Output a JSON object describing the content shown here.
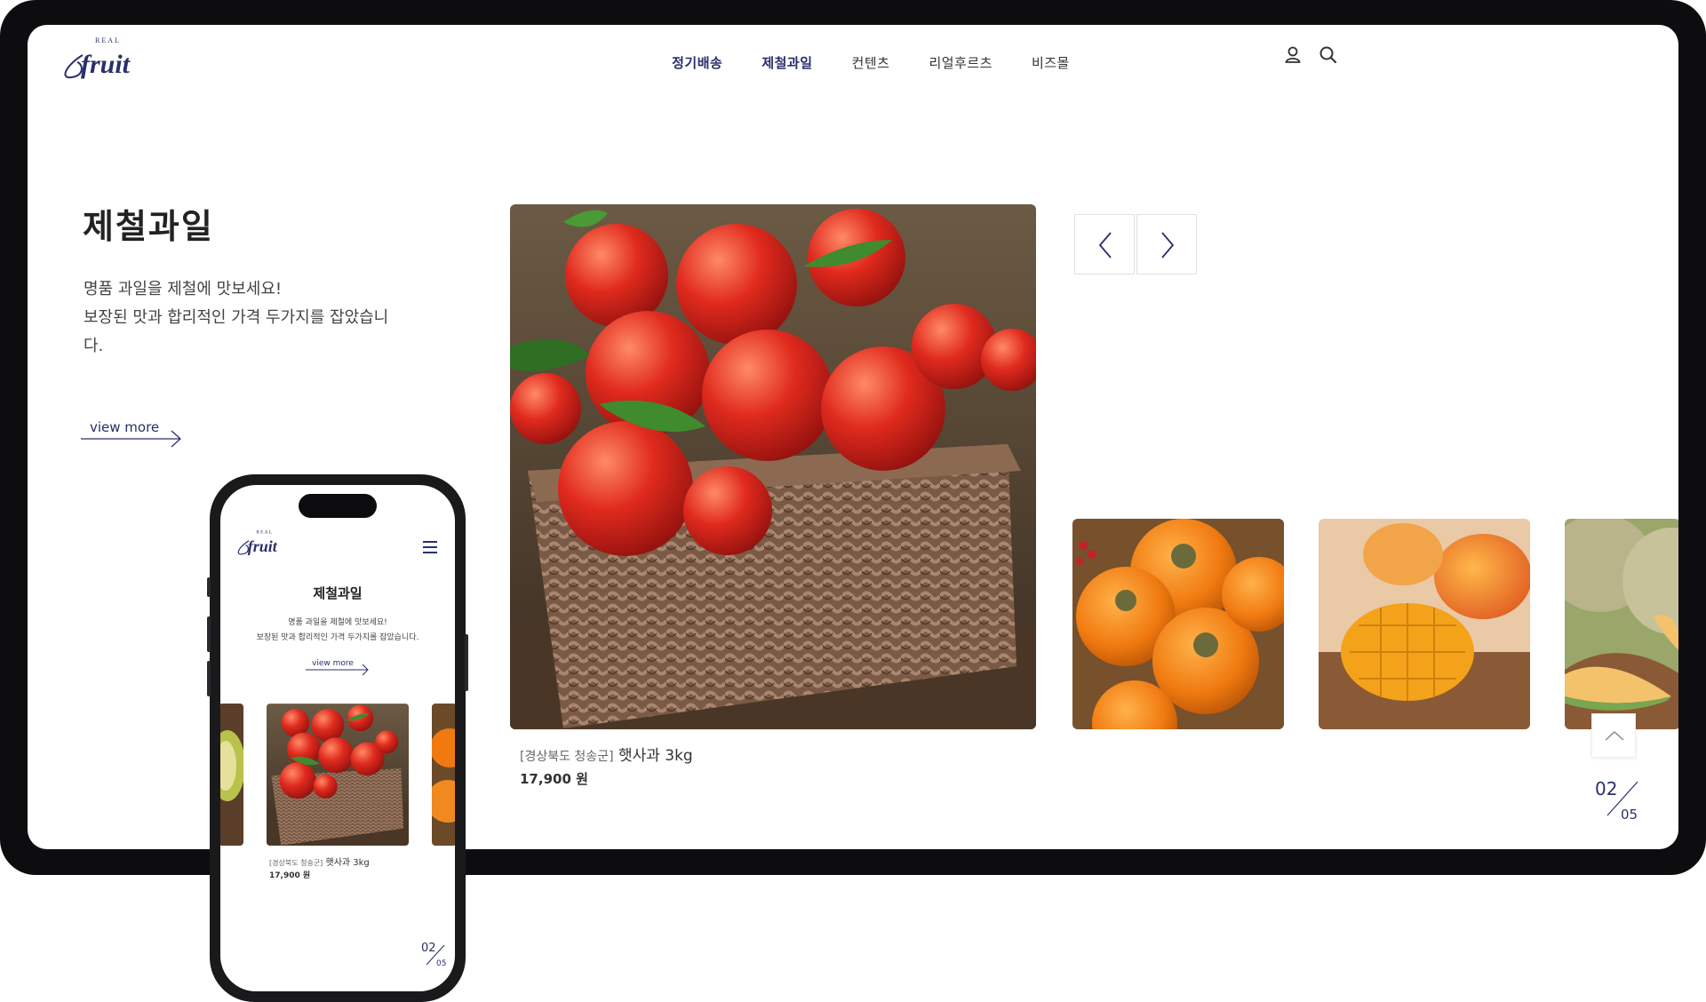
{
  "header": {
    "logo_small": "REAL",
    "logo_main": "fruit",
    "nav": [
      "정기배송",
      "제철과일",
      "컨텐츠",
      "리얼후르츠",
      "비즈몰"
    ]
  },
  "hero": {
    "title": "제철과일",
    "desc_line1": "명품 과일을 제철에 맛보세요!",
    "desc_line2": "보장된 맛과 합리적인 가격 두가지를 잡았습니",
    "desc_line3": "다.",
    "view_more": "view more"
  },
  "featured": {
    "region": "[경상북도 청송군]",
    "name": "햇사과 3kg",
    "price": "17,900 원"
  },
  "pager": {
    "current": "02",
    "total": "05"
  },
  "mobile": {
    "logo_small": "REAL",
    "logo_main": "fruit",
    "title": "제철과일",
    "desc_line1": "명품 과일을 제철에 맛보세요!",
    "desc_line2": "보장된 맛과 합리적인 가격 두가지를 잡았습니다.",
    "view_more": "view more",
    "region": "[경상북도 청송군]",
    "name": "햇사과 3kg",
    "price": "17,900 원",
    "pager_current": "02",
    "pager_total": "05"
  },
  "icons": {
    "user": "user-icon",
    "search": "search-icon",
    "prev": "chevron-left-icon",
    "next": "chevron-right-icon",
    "top": "chevron-up-icon",
    "menu": "hamburger-icon"
  },
  "colors": {
    "brand": "#2a2f6b",
    "frame": "#0d0d0f"
  }
}
